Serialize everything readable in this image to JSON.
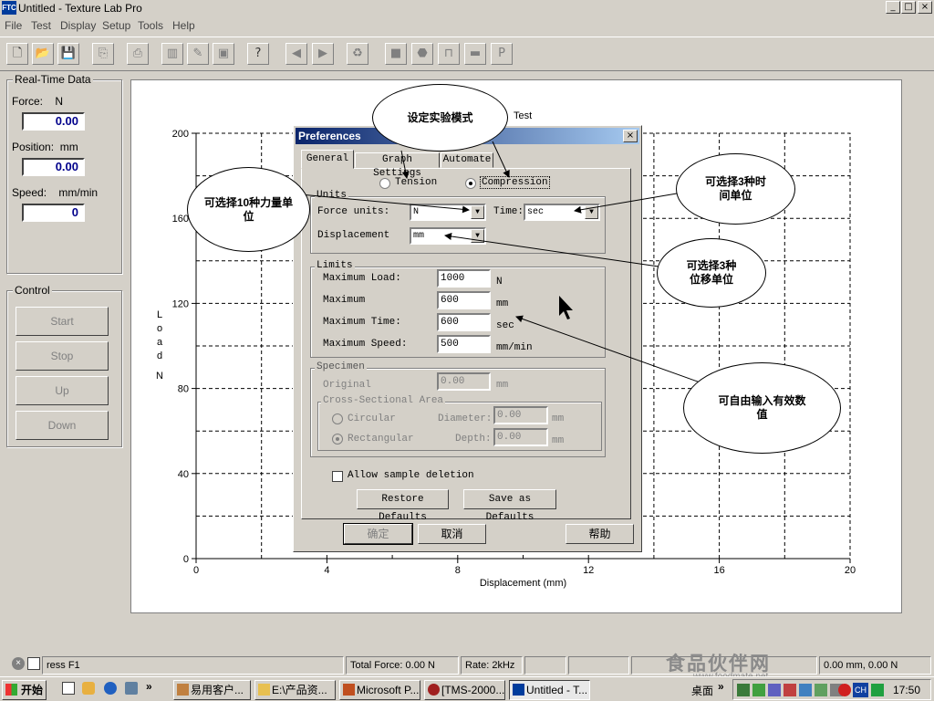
{
  "window": {
    "title": "Untitled - Texture Lab Pro",
    "icon_text": "FTC",
    "min": "_",
    "max": "□",
    "close": "×"
  },
  "menu": [
    "File",
    "Test",
    "Display",
    "Setup",
    "Tools",
    "Help"
  ],
  "realtime": {
    "group_label": "Real-Time Data",
    "force_label": "Force:    N",
    "force_value": "0.00",
    "position_label": "Position:  mm",
    "position_value": "0.00",
    "speed_label": "Speed:    mm/min",
    "speed_value": "0"
  },
  "control": {
    "group_label": "Control",
    "start": "Start",
    "stop": "Stop",
    "up": "Up",
    "down": "Down"
  },
  "chart_data": {
    "type": "line",
    "title": "Test",
    "xlabel": "Displacement (mm)",
    "ylabel": "Load",
    "yunit": "N",
    "xlim": [
      0,
      20
    ],
    "ylim": [
      0,
      200
    ],
    "xticks": [
      "0",
      "4",
      "8",
      "12",
      "16",
      "20"
    ],
    "yticks": [
      "0",
      "40",
      "80",
      "120",
      "160",
      "200"
    ],
    "grid": true,
    "series": []
  },
  "dialog": {
    "title": "Preferences",
    "close": "×",
    "tabs": [
      "General",
      "Graph Settings",
      "Automate"
    ],
    "mode": {
      "tension": "Tension",
      "compression": "Compression",
      "selected": "Compression"
    },
    "units": {
      "label": "Units",
      "force_label": "Force units:",
      "force_value": "N",
      "time_label": "Time:",
      "time_value": "sec",
      "displacement_label": "Displacement",
      "displacement_value": "mm"
    },
    "limits": {
      "label": "Limits",
      "max_load_label": "Maximum Load:",
      "max_load_value": "1000",
      "max_load_unit": "N",
      "max_label": "Maximum",
      "max_value": "600",
      "max_unit": "mm",
      "max_time_label": "Maximum Time:",
      "max_time_value": "600",
      "max_time_unit": "sec",
      "max_speed_label": "Maximum Speed:",
      "max_speed_value": "500",
      "max_speed_unit": "mm/min"
    },
    "specimen": {
      "label": "Specimen",
      "original_label": "Original",
      "original_value": "0.00",
      "original_unit": "mm",
      "cross_label": "Cross-Sectional Area",
      "circular": "Circular",
      "diameter_label": "Diameter:",
      "diameter_value": "0.00",
      "diameter_unit": "mm",
      "rectangular": "Rectangular",
      "depth_label": "Depth:",
      "depth_value": "0.00",
      "depth_unit": "mm",
      "selected": "Rectangular"
    },
    "allow_deletion": "Allow sample deletion",
    "restore_defaults": "Restore Defaults",
    "save_defaults": "Save as Defaults",
    "ok": "确定",
    "cancel": "取消",
    "help": "帮助"
  },
  "callouts": {
    "mode": "设定实验模式",
    "force_units": "可选择10种力量单位",
    "time_units": "可选择3种时间单位",
    "disp_units": "可选择3种位移单位",
    "free_input": "可自由输入有效数值"
  },
  "status": {
    "help": "ress F1",
    "total_force": "Total Force: 0.00 N",
    "rate": "Rate: 2kHz",
    "position": "0.00 mm, 0.00 N"
  },
  "watermark": {
    "cn": "食品伙伴网",
    "url": "www.foodmate.net"
  },
  "taskbar": {
    "start": "开始",
    "tasks": [
      "易用客户...",
      "E:\\产品资...",
      "Microsoft P...",
      "[TMS-2000...",
      "Untitled - T..."
    ],
    "desktop": "桌面",
    "lang": "CH",
    "clock": "17:50"
  }
}
